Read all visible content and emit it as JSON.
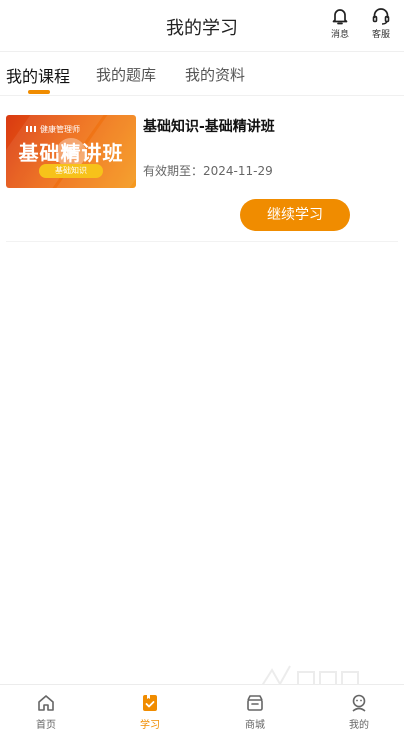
{
  "header": {
    "title": "我的学习",
    "messages_label": "消息",
    "service_label": "客服"
  },
  "tabs": [
    {
      "label": "我的课程",
      "active": true
    },
    {
      "label": "我的题库",
      "active": false
    },
    {
      "label": "我的资料",
      "active": false
    }
  ],
  "course": {
    "thumbnail": {
      "subtitle": "健康管理师",
      "main_title": "基础精讲班",
      "tag": "基础知识"
    },
    "title": "基础知识-基础精讲班",
    "expiry": "有效期至：2024-11-29",
    "continue_label": "继续学习"
  },
  "bottom_nav": [
    {
      "label": "首页",
      "icon": "home-icon",
      "active": false
    },
    {
      "label": "学习",
      "icon": "study-icon",
      "active": true
    },
    {
      "label": "商城",
      "icon": "store-icon",
      "active": false
    },
    {
      "label": "我的",
      "icon": "profile-icon",
      "active": false
    }
  ],
  "colors": {
    "accent": "#f08c00",
    "text": "#222222"
  }
}
